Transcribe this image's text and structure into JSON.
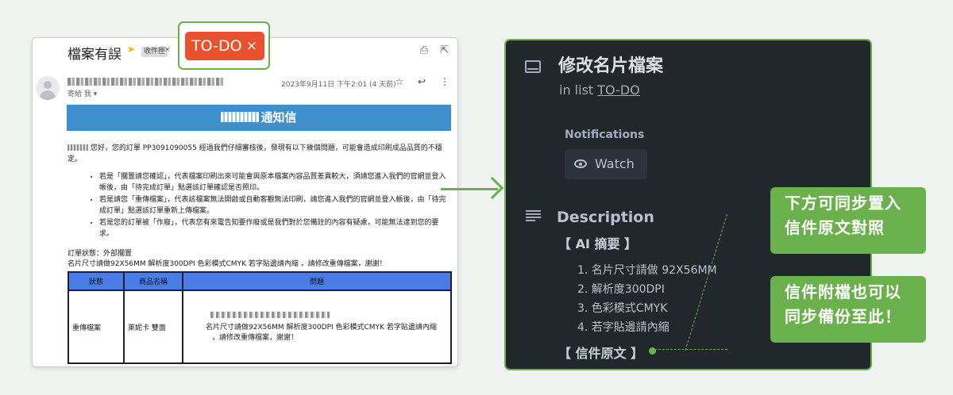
{
  "email": {
    "subject": "檔案有誤",
    "label": "收件匣",
    "label_close": "×",
    "to_me": "寄給 我 ▾",
    "date": "2023年9月11日 下午2:01 (4 天前)",
    "icons": [
      "print-icon",
      "open-new-icon",
      "star-icon",
      "reply-icon",
      "more-icon"
    ],
    "banner_suffix": "通知信",
    "greeting_suffix": " 您好，您的訂單 PP3091090055 經過我們仔細審核後，發現有以下幾個問題，可能會造成印刷成品品質的不穩定。",
    "bullets": [
      "若是「擱置請您確認」，代表檔案印刷出來可能會與原本檔案內容品質差異較大，須請您進入我們的官網並登入帳後，由「待完成訂單」點選該訂單確認是否照印。",
      "若是請您「重傳檔案」，代表該檔案無法開啟或自動客觀無法印刷，請您進入我們的官網並登入帳後，由「待完成訂單」點選該訂單重新上傳檔案。",
      "若是您的訂單被「作廢」，代表您有來電告知要作廢或是我們對於您備註的內容有疑慮，可能無法達到您的要求。"
    ],
    "order_status": "訂單狀態：外部擱置",
    "order_note": "名片尺寸請做92X56MM 解析度300DPI 色彩模式CMYK 若字貼邊請內縮 ，請修改重傳檔案，謝謝！",
    "table": {
      "headers": [
        "狀態",
        "商品名稱",
        "問題"
      ],
      "row": {
        "status": "重傳檔案",
        "product": "萊妮卡 雙面",
        "issue_line1": "名片尺寸請做92X56MM 解析度300DPI 色彩模式CMYK 若字貼邊請內縮",
        "issue_line2": "，請修改重傳檔案，謝謝！"
      }
    }
  },
  "todo_chip": {
    "label": "TO-DO",
    "close": "×"
  },
  "card": {
    "title": "修改名片檔案",
    "in_list_prefix": "in list ",
    "list_name": "TO-DO",
    "notifications_label": "Notifications",
    "watch_label": "Watch",
    "description_label": "Description",
    "ai_summary_title": "【 AI 摘要 】",
    "ai_items": [
      "1. 名片尺寸請做 92X56MM",
      "2. 解析度300DPI",
      "3. 色彩模式CMYK",
      "4. 若字貼邊請內縮"
    ],
    "original_title": "【 信件原文 】"
  },
  "callouts": {
    "top": [
      "下方可同步置入",
      "信件原文對照"
    ],
    "bottom": [
      "信件附檔也可以",
      "同步備份至此！"
    ]
  },
  "colors": {
    "accent_green": "#6ab04c",
    "todo_red": "#e8522f",
    "card_bg": "#22272b",
    "banner_blue": "#3f8fcd"
  }
}
